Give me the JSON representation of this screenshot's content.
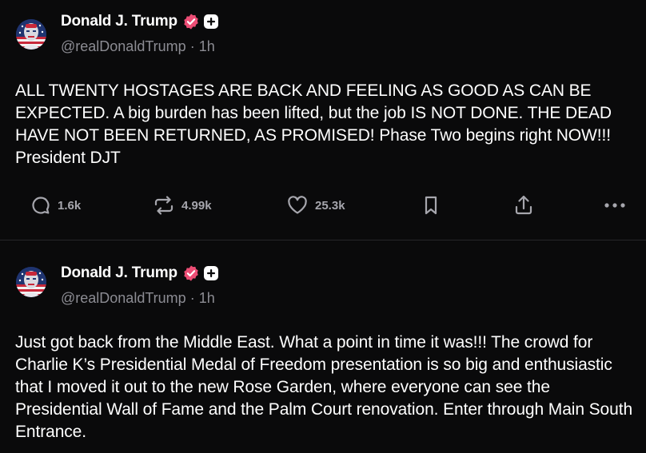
{
  "posts": [
    {
      "author": "Donald J. Trump",
      "handle": "@realDonaldTrump",
      "separator": "·",
      "time": "1h",
      "text": "ALL TWENTY HOSTAGES ARE BACK AND FEELING AS GOOD AS CAN BE EXPECTED. A big burden has been lifted, but the job IS NOT DONE. THE DEAD HAVE NOT BEEN RETURNED, AS PROMISED! Phase Two begins right NOW!!! President DJT",
      "stats": {
        "replies": "1.6k",
        "restruths": "4.99k",
        "likes": "25.3k"
      }
    },
    {
      "author": "Donald J. Trump",
      "handle": "@realDonaldTrump",
      "separator": "·",
      "time": "1h",
      "text": "Just got back from the Middle East. What a point in time it was!!! The crowd for Charlie K’s Presidential Medal of Freedom presentation is so big and enthusiastic that I moved it out to the new Rose Garden, where everyone can see the Presidential Wall of Fame and the Palm Court renovation. Enter through Main South Entrance."
    }
  ],
  "icons": {
    "verified": "verified-badge-icon",
    "plus": "plus-icon",
    "reply": "reply-bubble-icon",
    "restruth": "repost-arrows-icon",
    "like": "heart-icon",
    "bookmark": "bookmark-icon",
    "share": "share-icon",
    "more": "more-dots-icon"
  },
  "colors": {
    "background": "#0a0a0b",
    "text": "#ffffff",
    "muted": "#8c8c93",
    "verified": "#ec4d75",
    "divider": "#26262a"
  }
}
